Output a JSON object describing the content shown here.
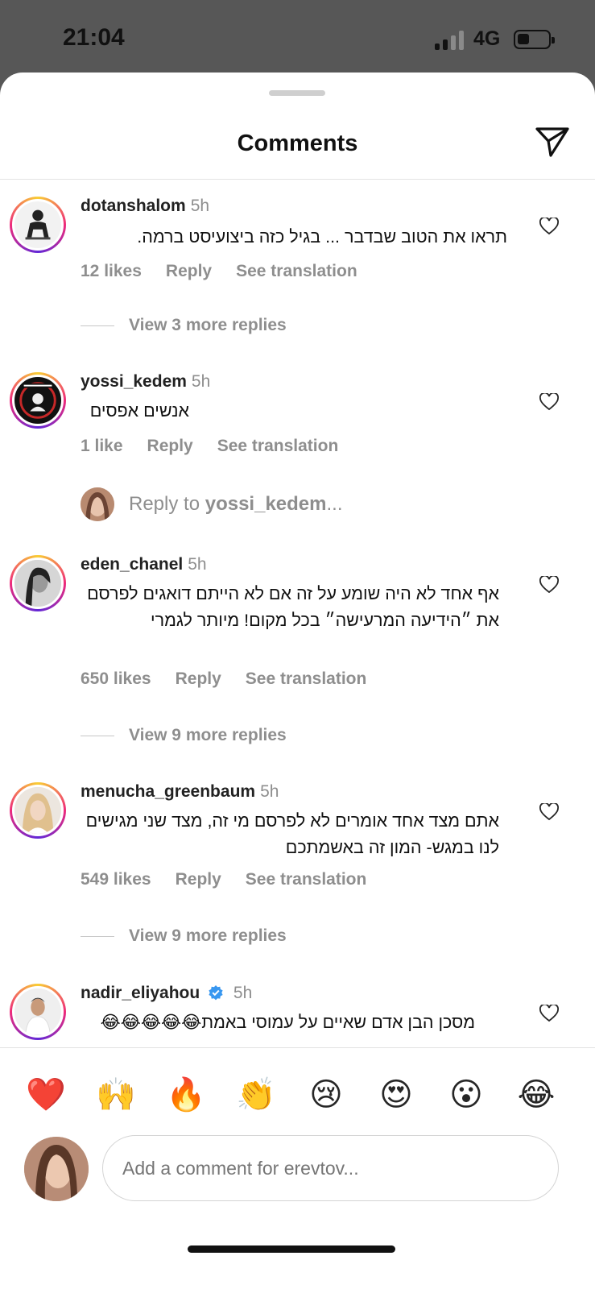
{
  "status_bar": {
    "time": "21:04",
    "network": "4G"
  },
  "sheet": {
    "title": "Comments"
  },
  "comments": [
    {
      "username": "dotanshalom",
      "time": "5h",
      "text": "תראו את הטוב שבדבר ... בגיל כזה ביצועיסט ברמה.",
      "likes": "12 likes",
      "reply": "Reply",
      "translate": "See translation",
      "view_replies": "View 3 more replies"
    },
    {
      "username": "yossi_kedem",
      "time": "5h",
      "text": "אנשים אפסים",
      "likes": "1 like",
      "reply": "Reply",
      "translate": "See translation"
    },
    {
      "username": "eden_chanel",
      "time": "5h",
      "text": "אף אחד לא היה שומע על זה אם לא הייתם דואגים לפרסם את ״הידיעה המרעישה״ בכל מקום! מיותר לגמרי",
      "likes": "650 likes",
      "reply": "Reply",
      "translate": "See translation",
      "view_replies": "View 9 more replies"
    },
    {
      "username": "menucha_greenbaum",
      "time": "5h",
      "text": "אתם מצד אחד אומרים לא לפרסם מי זה, מצד שני מגישים לנו במגש- המון זה באשמתכם",
      "likes": "549 likes",
      "reply": "Reply",
      "translate": "See translation",
      "view_replies": "View 9 more replies"
    },
    {
      "username": "nadir_eliyahou",
      "time": "5h",
      "text": "מסכן הבן אדם שאיים על עמוסי באמת😂😂😂😂😂"
    }
  ],
  "reply_to": {
    "prefix": "Reply to ",
    "username": "yossi_kedem",
    "suffix": "..."
  },
  "emojis": [
    "❤️",
    "🙌",
    "🔥",
    "👏",
    "😢",
    "😍",
    "😮",
    "😂"
  ],
  "composer": {
    "placeholder": "Add a comment for erevtov..."
  },
  "colors": {
    "accent": "#0095f6",
    "muted": "#8e8e8e",
    "verified": "#3897f0"
  }
}
